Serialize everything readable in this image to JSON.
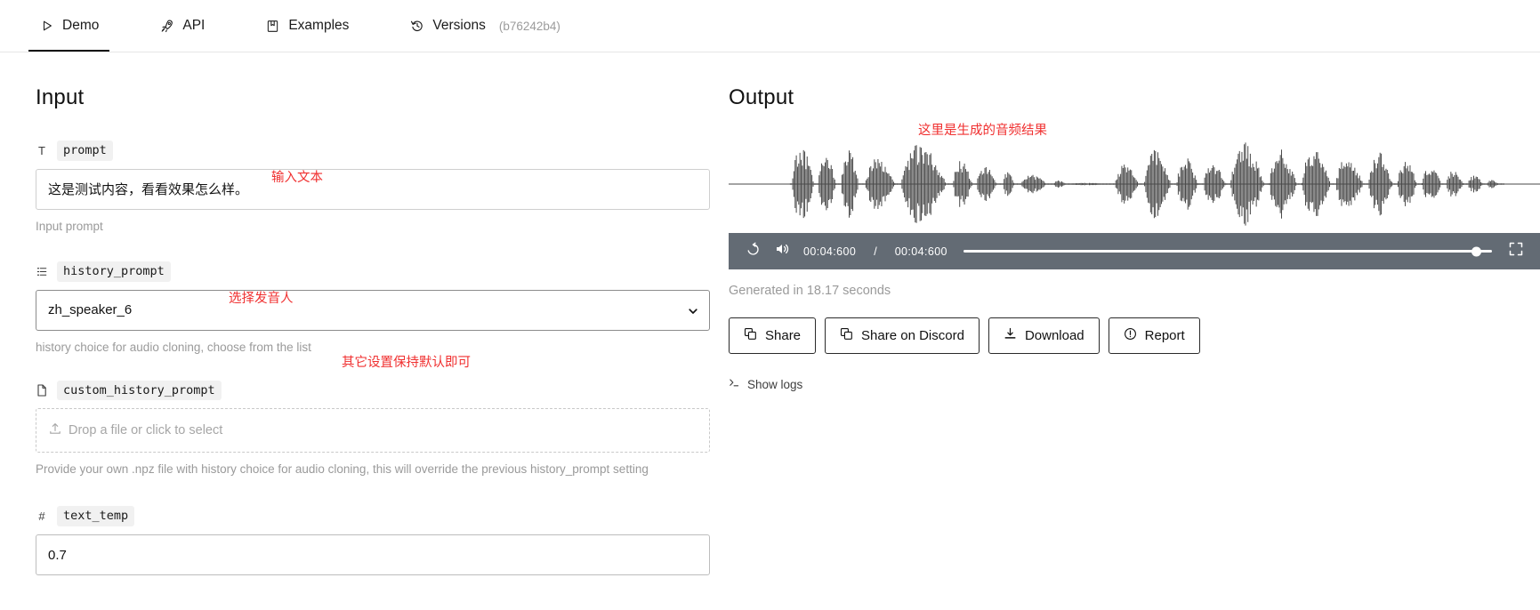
{
  "tabs": [
    {
      "label": "Demo",
      "icon": "play-icon",
      "active": true,
      "suffix": ""
    },
    {
      "label": "API",
      "icon": "rocket-icon",
      "active": false,
      "suffix": ""
    },
    {
      "label": "Examples",
      "icon": "book-icon",
      "active": false,
      "suffix": ""
    },
    {
      "label": "Versions",
      "icon": "history-icon",
      "active": false,
      "suffix": "(b76242b4)"
    }
  ],
  "input": {
    "title": "Input",
    "prompt": {
      "type_icon": "T",
      "name": "prompt",
      "value": "这是测试内容，看看效果怎么样。",
      "help": "Input prompt",
      "annotation": "输入文本"
    },
    "history_prompt": {
      "type_icon": "list",
      "name": "history_prompt",
      "value": "zh_speaker_6",
      "help": "history choice for audio cloning, choose from the list",
      "annotation": "选择发音人"
    },
    "custom_history_prompt": {
      "type_icon": "file",
      "name": "custom_history_prompt",
      "placeholder": "Drop a file or click to select",
      "help": "Provide your own .npz file with history choice for audio cloning, this will override the previous history_prompt setting",
      "annotation": "其它设置保持默认即可"
    },
    "text_temp": {
      "type_icon": "#",
      "name": "text_temp",
      "value": "0.7"
    }
  },
  "output": {
    "title": "Output",
    "annotation": "这里是生成的音频结果",
    "player": {
      "replay_icon": "replay-icon",
      "volume_icon": "volume-icon",
      "current_time": "00:04:600",
      "separator": "/",
      "duration": "00:04:600",
      "fullscreen_icon": "fullscreen-icon",
      "progress_percent": 97
    },
    "generated_note": "Generated in 18.17 seconds",
    "buttons": [
      {
        "label": "Share",
        "icon": "copy-icon"
      },
      {
        "label": "Share on Discord",
        "icon": "copy-icon"
      },
      {
        "label": "Download",
        "icon": "download-icon"
      },
      {
        "label": "Report",
        "icon": "alert-circle-icon"
      }
    ],
    "show_logs": "Show logs"
  },
  "colors": {
    "annotation_red": "#f03030",
    "player_bar": "#636b74",
    "waveform": "#4a4a4a",
    "muted_text": "#9a9a9a"
  }
}
